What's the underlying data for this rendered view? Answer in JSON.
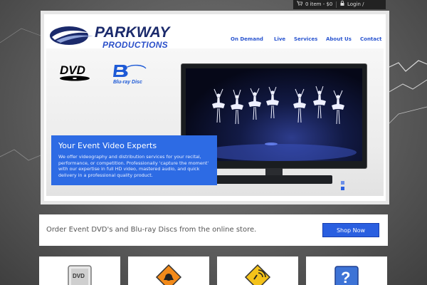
{
  "topbar": {
    "cart_label": "0 item - $0",
    "login_label": "Login / Register",
    "cart_icon": "cart-icon",
    "lock_icon": "lock-icon"
  },
  "brand": {
    "name_line1": "PARKWAY",
    "name_line2": "PRODUCTIONS"
  },
  "nav": {
    "items": [
      {
        "label": "On Demand"
      },
      {
        "label": "Live"
      },
      {
        "label": "Services"
      },
      {
        "label": "About Us"
      },
      {
        "label": "Contact"
      }
    ]
  },
  "hero": {
    "dvd_logo_text": "DVD",
    "dvd_logo_subtext": "VIDEO",
    "bluray_logo_text": "Blu-ray Disc",
    "title": "Your Event Video Experts",
    "body": "We offer videography and distribution services for your recital, performance, or competition. Professionally 'capture the moment' with our expertise in full HD video, mastered audio, and quick delivery in a professional quality product."
  },
  "order": {
    "text": "Order Event DVD's and Blu-ray Discs from the online store.",
    "button_label": "Shop Now"
  },
  "features": [
    {
      "icon": "dvd-case-icon"
    },
    {
      "icon": "construction-sign-icon"
    },
    {
      "icon": "live-broadcast-sign-icon"
    },
    {
      "icon": "question-mark-icon"
    }
  ],
  "colors": {
    "accent": "#2b56d0",
    "caption_bg": "#2d6be4",
    "button_bg": "#2a5fe0",
    "brand_dark": "#1b2a6b"
  }
}
